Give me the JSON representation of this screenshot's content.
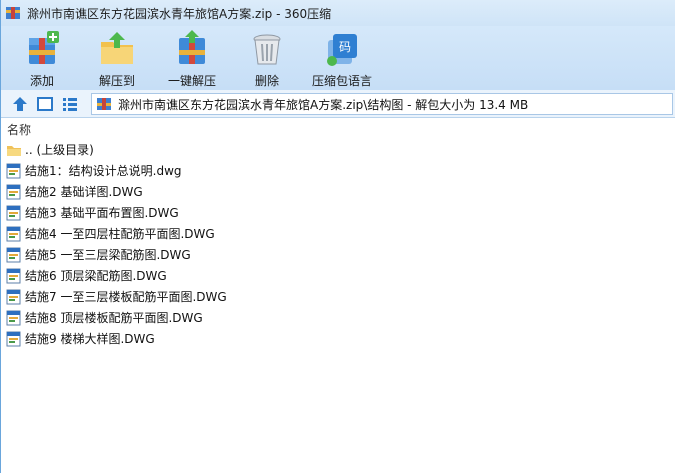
{
  "window": {
    "title": "滁州市南谯区东方花园滨水青年旅馆A方案.zip - 360压缩"
  },
  "toolbar": {
    "items": [
      {
        "label": "添加",
        "icon": "add-archive-icon"
      },
      {
        "label": "解压到",
        "icon": "extract-to-icon"
      },
      {
        "label": "一键解压",
        "icon": "one-click-extract-icon"
      },
      {
        "label": "删除",
        "icon": "delete-trash-icon"
      },
      {
        "label": "压缩包语言",
        "icon": "archive-language-icon"
      }
    ]
  },
  "address": {
    "path": "滁州市南谯区东方花园滨水青年旅馆A方案.zip\\结构图 - 解包大小为 13.4 MB"
  },
  "list": {
    "column_name": "名称",
    "parent": ".. (上级目录)",
    "files": [
      "结施1：结构设计总说明.dwg",
      "结施2 基础详图.DWG",
      "结施3 基础平面布置图.DWG",
      "结施4 一至四层柱配筋平面图.DWG",
      "结施5 一至三层梁配筋图.DWG",
      "结施6 顶层梁配筋图.DWG",
      "结施7 一至三层楼板配筋平面图.DWG",
      "结施8 顶层楼板配筋平面图.DWG",
      "结施9 楼梯大样图.DWG"
    ]
  },
  "colors": {
    "titlebar": "#cfe4f7",
    "toolbar": "#c6def6",
    "accent": "#2b79c9"
  }
}
